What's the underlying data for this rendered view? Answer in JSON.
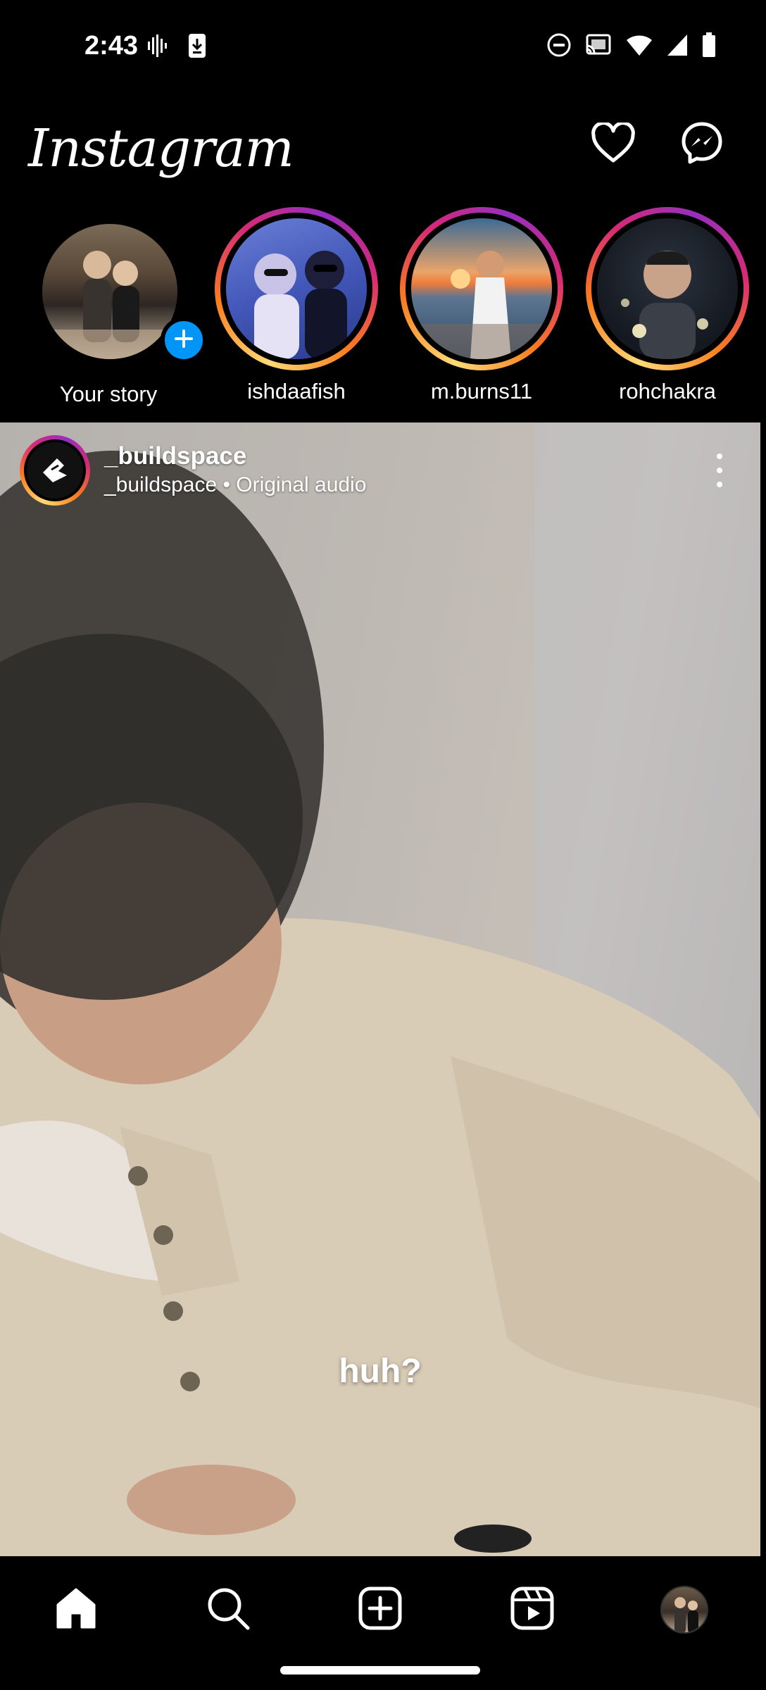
{
  "status_bar": {
    "time": "2:43",
    "left_icons": [
      "voicemail-icon",
      "download-icon"
    ],
    "right_icons": [
      "do-not-disturb-icon",
      "cast-icon",
      "wifi-icon",
      "signal-icon",
      "battery-icon"
    ]
  },
  "header": {
    "logo_text": "Instagram",
    "notifications_icon": "heart-icon",
    "messages_icon": "messenger-icon"
  },
  "stories": [
    {
      "name": "Your story",
      "own": true
    },
    {
      "name": "ishdaafish"
    },
    {
      "name": "m.burns11"
    },
    {
      "name": "rohchakra"
    }
  ],
  "post": {
    "username": "_buildspace",
    "subtitle": "_buildspace • Original audio",
    "caption": "huh?",
    "more_icon": "more-vertical-icon"
  },
  "bottom_nav": {
    "items": [
      "home-icon",
      "search-icon",
      "create-post-icon",
      "reels-icon",
      "profile-avatar"
    ]
  },
  "colors": {
    "background": "#000000",
    "accent_blue": "#0095f6",
    "story_ring_gradient": [
      "#feda75",
      "#fa7e1e",
      "#d62976",
      "#962fbf"
    ]
  }
}
